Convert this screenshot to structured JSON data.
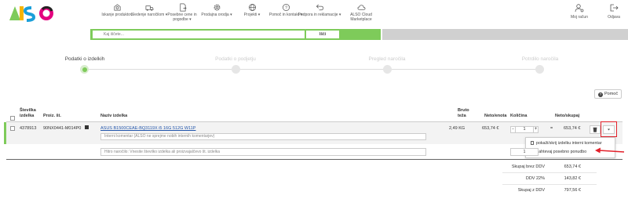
{
  "brand": {
    "logo_text": "ALSO",
    "accent": "#7ecb5a",
    "highlight_red": "#e3202a"
  },
  "nav": {
    "items": [
      {
        "label": "Iskanje produktov",
        "icon": "search-box-icon"
      },
      {
        "label": "Sledenje naročilom ▾",
        "icon": "truck-icon"
      },
      {
        "label": "Posebne cene in pogodbe ▾",
        "icon": "document-icon"
      },
      {
        "label": "Prodajna orodja ▾",
        "icon": "gear-icon"
      },
      {
        "label": "Projekti ▾",
        "icon": "globe-icon"
      },
      {
        "label": "Pomoč in kontakt ▾",
        "icon": "question-icon"
      },
      {
        "label": "Podpora in reklamacije ▾",
        "icon": "return-arrow-icon"
      },
      {
        "label": "ALSO Cloud Marketplace",
        "icon": "cloud-icon"
      }
    ],
    "account_label": "Moj račun",
    "logout_label": "Odjava"
  },
  "search": {
    "placeholder": "Kaj iščete...",
    "button_label": "Išči"
  },
  "steps": [
    {
      "label": "Podatki o izdelkih",
      "active": true
    },
    {
      "label": "Podatki o podjetju",
      "active": false
    },
    {
      "label": "Pregled naročila",
      "active": false
    },
    {
      "label": "Potrdilo naročila",
      "active": false
    }
  ],
  "help_label": "Pomoč",
  "table": {
    "headers": {
      "item_no": "Številka izdelka",
      "mfr_no": "Proiz. št.",
      "name": "Naziv izdelka",
      "gross_weight": "Bruto teža",
      "net_unit": "Neto/enota",
      "quantity": "Količina",
      "net_total": "Neto/skupaj"
    },
    "row": {
      "item_no": "4378913",
      "mfr_no": "90NX0441-M014P0",
      "name": "ASUS B1500CEAE-BQ3119X i5 16G 512G W11P",
      "weight": "2,49 KG",
      "net_unit": "653,74 €",
      "quantity": "1",
      "net_total": "653,74 €",
      "comment_placeholder": "Interni komentar (ALSO ne sprejme nobih internih komentarjev)"
    },
    "quick_order": {
      "placeholder": "Hitro naročilo: Vnesite številko izdelka ali proizvajalčevo št. izdelka",
      "quantity": "1"
    }
  },
  "dropdown": {
    "items": [
      "pokaži/skrij izdelku interni komentar",
      "Zahtevaj posebno ponudbo"
    ]
  },
  "totals": [
    {
      "label": "Skupaj brez DDV",
      "value": "653,74 €"
    },
    {
      "label": "DDV 22%",
      "value": "143,82 €"
    },
    {
      "label": "Skupaj z DDV",
      "value": "797,56 €"
    }
  ]
}
